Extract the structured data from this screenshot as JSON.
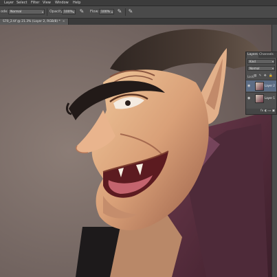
{
  "menubar": {
    "items": [
      "Layer",
      "Select",
      "Filter",
      "View",
      "Window",
      "Help"
    ]
  },
  "options": {
    "mode_label": "ode:",
    "mode_value": "Normal",
    "opacity_label": "Opacity:",
    "opacity_value": "100%",
    "flow_label": "Flow:",
    "flow_value": "100%"
  },
  "document": {
    "tab_title": "S70_2.tif @ 21.3% (Layer 2, RGB/8) *",
    "close_glyph": "×"
  },
  "layers_panel": {
    "tabs": [
      "Layers",
      "Channels"
    ],
    "filter_value": "Kind",
    "blend_value": "Normal",
    "lock_label": "Lock:",
    "lock_icons": "▧ ✎ ✥ 🔒",
    "layers": [
      {
        "name": "Layer 2",
        "selected": true
      },
      {
        "name": "Layer 1",
        "selected": false
      }
    ],
    "footer_icons": "fx ◐ ▭ ▣"
  },
  "colors": {
    "ui_dark": "#3c3c3c",
    "selected_layer": "#5c6d85",
    "cape": "#4e2a39"
  }
}
